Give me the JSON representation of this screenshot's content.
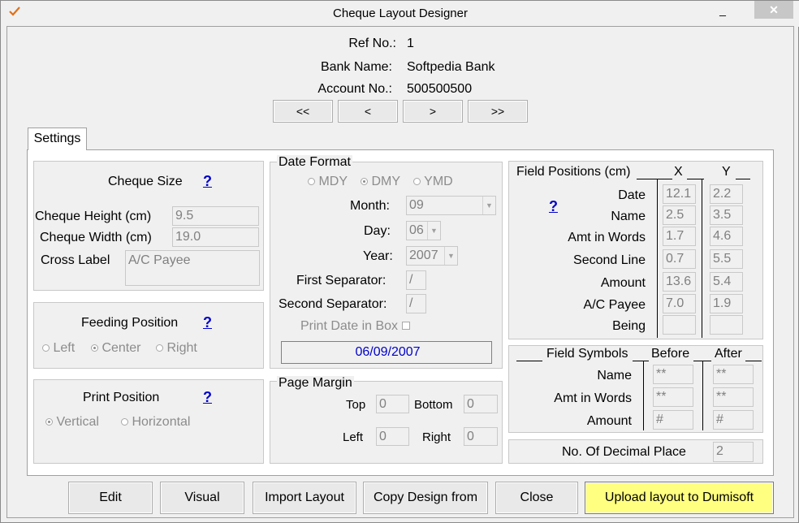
{
  "window": {
    "title": "Cheque Layout Designer",
    "close_glyph": "✕",
    "min_glyph": "_",
    "max_glyph": "□"
  },
  "header": {
    "ref_label": "Ref No.:",
    "ref_value": "1",
    "bank_label": "Bank Name:",
    "bank_value": "Softpedia Bank",
    "account_label": "Account No.:",
    "account_value": "500500500"
  },
  "nav": {
    "first": "<<",
    "prev": "<",
    "next": ">",
    "last": ">>"
  },
  "tab": {
    "label": "Settings"
  },
  "cheque_size": {
    "title": "Cheque Size",
    "help": "?",
    "height_label": "Cheque Height (cm)",
    "height_value": "9.5",
    "width_label": "Cheque Width (cm)",
    "width_value": "19.0",
    "cross_label": "Cross Label",
    "cross_value": "A/C Payee"
  },
  "feeding": {
    "title": "Feeding Position",
    "help": "?",
    "options": [
      "Left",
      "Center",
      "Right"
    ],
    "selected": "Center"
  },
  "print_position": {
    "title": "Print Position",
    "help": "?",
    "options": [
      "Vertical",
      "Horizontal"
    ],
    "selected": "Vertical"
  },
  "date_format": {
    "title": "Date Format",
    "options": [
      "MDY",
      "DMY",
      "YMD"
    ],
    "selected": "DMY",
    "month_label": "Month:",
    "month_value": "09",
    "day_label": "Day:",
    "day_value": "06",
    "year_label": "Year:",
    "year_value": "2007",
    "first_sep_label": "First Separator:",
    "first_sep_value": "/",
    "second_sep_label": "Second Separator:",
    "second_sep_value": "/",
    "print_box_label": "Print Date in Box",
    "preview": "06/09/2007"
  },
  "page_margin": {
    "title": "Page Margin",
    "top_label": "Top",
    "top_value": "0",
    "bottom_label": "Bottom",
    "bottom_value": "0",
    "left_label": "Left",
    "left_value": "0",
    "right_label": "Right",
    "right_value": "0"
  },
  "field_positions": {
    "title": "Field Positions (cm)",
    "x_header": "X",
    "y_header": "Y",
    "help": "?",
    "rows": [
      {
        "label": "Date",
        "x": "12.1",
        "y": "2.2"
      },
      {
        "label": "Name",
        "x": "2.5",
        "y": "3.5"
      },
      {
        "label": "Amt in Words",
        "x": "1.7",
        "y": "4.6"
      },
      {
        "label": "Second Line",
        "x": "0.7",
        "y": "5.5"
      },
      {
        "label": "Amount",
        "x": "13.6",
        "y": "5.4"
      },
      {
        "label": "A/C Payee",
        "x": "7.0",
        "y": "1.9"
      },
      {
        "label": "Being",
        "x": "",
        "y": ""
      }
    ]
  },
  "field_symbols": {
    "title": "Field Symbols",
    "before_header": "Before",
    "after_header": "After",
    "rows": [
      {
        "label": "Name",
        "before": "**",
        "after": "**"
      },
      {
        "label": "Amt in Words",
        "before": "**",
        "after": "**"
      },
      {
        "label": "Amount",
        "before": "#",
        "after": "#"
      }
    ]
  },
  "decimal": {
    "label": "No. Of Decimal Place",
    "value": "2"
  },
  "buttons": {
    "edit": "Edit",
    "visual": "Visual",
    "import": "Import Layout",
    "copy": "Copy Design from",
    "close": "Close",
    "upload": "Upload layout to Dumisoft"
  },
  "colors": {
    "upload_bg": "#ffff80",
    "help_link": "#0000cc",
    "preview_text": "#0000cc"
  }
}
